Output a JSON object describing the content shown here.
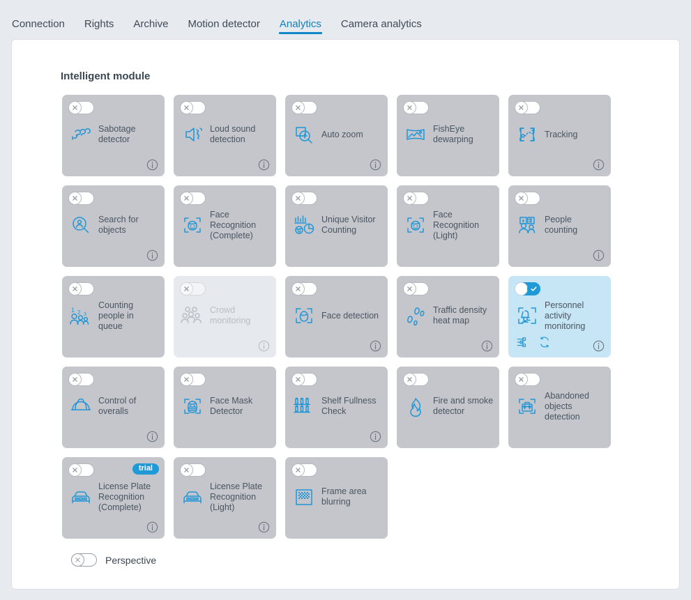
{
  "tabs": [
    {
      "label": "Connection",
      "active": false
    },
    {
      "label": "Rights",
      "active": false
    },
    {
      "label": "Archive",
      "active": false
    },
    {
      "label": "Motion detector",
      "active": false
    },
    {
      "label": "Analytics",
      "active": true
    },
    {
      "label": "Camera analytics",
      "active": false
    }
  ],
  "section": {
    "title": "Intelligent module"
  },
  "colors": {
    "accent": "#1f9ad6",
    "tab_active": "#0e7fc1",
    "card_bg": "#c4c6cc",
    "card_bg_active": "#c6e5f5",
    "card_bg_disabled": "#e6e9ed",
    "page_bg": "#e7eaee",
    "panel_bg": "#ffffff",
    "label": "#4a555f"
  },
  "modules": [
    {
      "label": "Sabotage detector",
      "icon": "sabotage-detector-icon",
      "state": "off",
      "info": true,
      "trial": false,
      "disabled": false,
      "actions": []
    },
    {
      "label": "Loud sound detection",
      "icon": "loud-sound-icon",
      "state": "off",
      "info": true,
      "trial": false,
      "disabled": false,
      "actions": []
    },
    {
      "label": "Auto zoom",
      "icon": "auto-zoom-icon",
      "state": "off",
      "info": true,
      "trial": false,
      "disabled": false,
      "actions": []
    },
    {
      "label": "FishEye dewarping",
      "icon": "fisheye-dewarping-icon",
      "state": "off",
      "info": false,
      "trial": false,
      "disabled": false,
      "actions": []
    },
    {
      "label": "Tracking",
      "icon": "tracking-icon",
      "state": "off",
      "info": true,
      "trial": false,
      "disabled": false,
      "actions": []
    },
    {
      "label": "Search for objects",
      "icon": "search-objects-icon",
      "state": "off",
      "info": true,
      "trial": false,
      "disabled": false,
      "actions": []
    },
    {
      "label": "Face Recognition (Complete)",
      "icon": "face-recognition-icon",
      "state": "off",
      "info": false,
      "trial": false,
      "disabled": false,
      "actions": []
    },
    {
      "label": "Unique Visitor Counting",
      "icon": "unique-visitor-counting-icon",
      "state": "off",
      "info": false,
      "trial": false,
      "disabled": false,
      "actions": []
    },
    {
      "label": "Face Recognition (Light)",
      "icon": "face-recognition-icon",
      "state": "off",
      "info": false,
      "trial": false,
      "disabled": false,
      "actions": []
    },
    {
      "label": "People counting",
      "icon": "people-counting-icon",
      "state": "off",
      "info": true,
      "trial": false,
      "disabled": false,
      "actions": []
    },
    {
      "label": "Counting people in queue",
      "icon": "counting-queue-icon",
      "state": "off",
      "info": false,
      "trial": false,
      "disabled": false,
      "actions": []
    },
    {
      "label": "Crowd monitoring",
      "icon": "crowd-monitoring-icon",
      "state": "off",
      "info": true,
      "trial": false,
      "disabled": true,
      "actions": []
    },
    {
      "label": "Face detection",
      "icon": "face-detection-icon",
      "state": "off",
      "info": true,
      "trial": false,
      "disabled": false,
      "actions": []
    },
    {
      "label": "Traffic density heat map",
      "icon": "heat-map-icon",
      "state": "off",
      "info": true,
      "trial": false,
      "disabled": false,
      "actions": []
    },
    {
      "label": "Personnel activity monitoring",
      "icon": "personnel-activity-icon",
      "state": "on",
      "info": true,
      "trial": false,
      "disabled": false,
      "actions": [
        "settings-sliders-icon",
        "refresh-icon"
      ]
    },
    {
      "label": "Control of overalls",
      "icon": "overalls-icon",
      "state": "off",
      "info": true,
      "trial": false,
      "disabled": false,
      "actions": []
    },
    {
      "label": "Face Mask Detector",
      "icon": "face-mask-icon",
      "state": "off",
      "info": false,
      "trial": false,
      "disabled": false,
      "actions": []
    },
    {
      "label": "Shelf Fullness Check",
      "icon": "shelf-fullness-icon",
      "state": "off",
      "info": true,
      "trial": false,
      "disabled": false,
      "actions": []
    },
    {
      "label": "Fire and smoke detector",
      "icon": "fire-smoke-icon",
      "state": "off",
      "info": false,
      "trial": false,
      "disabled": false,
      "actions": []
    },
    {
      "label": "Abandoned objects detection",
      "icon": "abandoned-objects-icon",
      "state": "off",
      "info": false,
      "trial": false,
      "disabled": false,
      "actions": []
    },
    {
      "label": "License Plate Recognition (Complete)",
      "icon": "license-plate-icon",
      "state": "off",
      "info": true,
      "trial": true,
      "trial_label": "trial",
      "disabled": false,
      "actions": []
    },
    {
      "label": "License Plate Recognition (Light)",
      "icon": "license-plate-icon",
      "state": "off",
      "info": true,
      "trial": false,
      "disabled": false,
      "actions": []
    },
    {
      "label": "Frame area blurring",
      "icon": "frame-blur-icon",
      "state": "off",
      "info": false,
      "trial": false,
      "disabled": false,
      "actions": []
    }
  ],
  "perspective": {
    "label": "Perspective",
    "state": "off"
  }
}
